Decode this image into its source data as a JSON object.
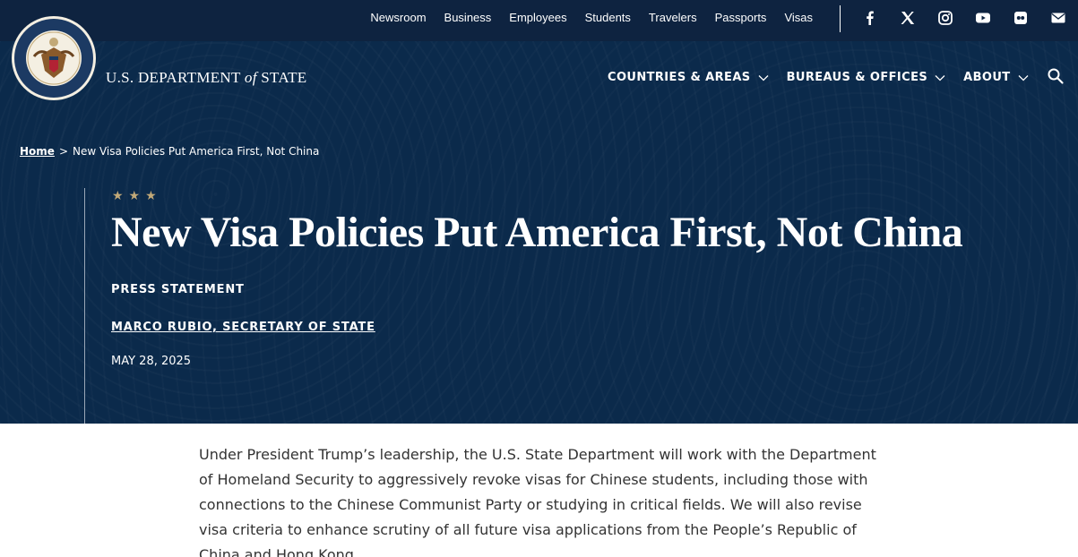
{
  "header": {
    "utility_nav": [
      "Newsroom",
      "Business",
      "Employees",
      "Students",
      "Travelers",
      "Passports",
      "Visas"
    ],
    "social_icons": [
      "facebook-icon",
      "x-icon",
      "instagram-icon",
      "youtube-icon",
      "flickr-icon",
      "email-icon"
    ],
    "agency_name_prefix": "U.S. DEPARTMENT ",
    "agency_name_of": "of",
    "agency_name_suffix": " STATE",
    "seal_label": "DEPARTMENT OF STATE · UNITED STATES OF AMERICA",
    "main_nav": [
      "COUNTRIES & AREAS",
      "BUREAUS & OFFICES",
      "ABOUT"
    ]
  },
  "breadcrumb": {
    "home": "Home",
    "separator": ">",
    "current": "New Visa Policies Put America First, Not China"
  },
  "article": {
    "stars": "★★★",
    "title": "New Visa Policies Put America First, Not China",
    "type": "PRESS STATEMENT",
    "author": "MARCO RUBIO, SECRETARY OF STATE",
    "date": "MAY 28, 2025",
    "body": "Under President Trump’s leadership, the U.S. State Department will work with the Department of Homeland Security to aggressively revoke visas for Chinese students, including those with connections to the Chinese Communist Party or studying in critical fields. We will also revise visa criteria to enhance scrutiny of all future visa applications from the People’s Republic of China and Hong Kong."
  },
  "colors": {
    "topbar": "#0e2340",
    "hero": "#0b2a4b",
    "accent_gold": "#c2a978",
    "body_text": "#333333"
  }
}
